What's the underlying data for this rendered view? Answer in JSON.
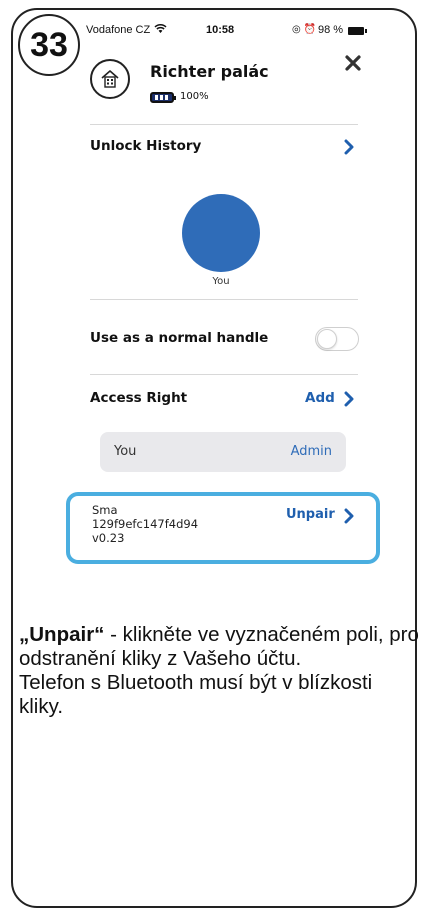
{
  "step_number": "33",
  "status_bar": {
    "carrier": "Vodafone CZ",
    "time": "10:58",
    "battery_percent": "98 %"
  },
  "lock": {
    "name": "Richter palác",
    "battery": "100%"
  },
  "unlock_history": {
    "label": "Unlock History",
    "avatar_label": "You"
  },
  "normal_handle": {
    "label": "Use as a normal handle",
    "enabled": false
  },
  "access_right": {
    "label": "Access Right",
    "add_label": "Add",
    "users": [
      {
        "name": "You",
        "role": "Admin"
      }
    ]
  },
  "device": {
    "name": "Sma",
    "id": "129f9efc147f4d94",
    "version": "v0.23",
    "unpair_label": "Unpair"
  },
  "colors": {
    "accent_blue": "#2f6cb8",
    "highlight_border": "#4aaee0",
    "battery_fill": "#1c2f6a"
  },
  "instructions": {
    "highlight": "„Unpair“",
    "line1": " - klikněte ve vyznačeném poli, pro odstranění kliky z Vašeho účtu.",
    "line2": "Telefon s Bluetooth musí být v blízkosti kliky."
  }
}
